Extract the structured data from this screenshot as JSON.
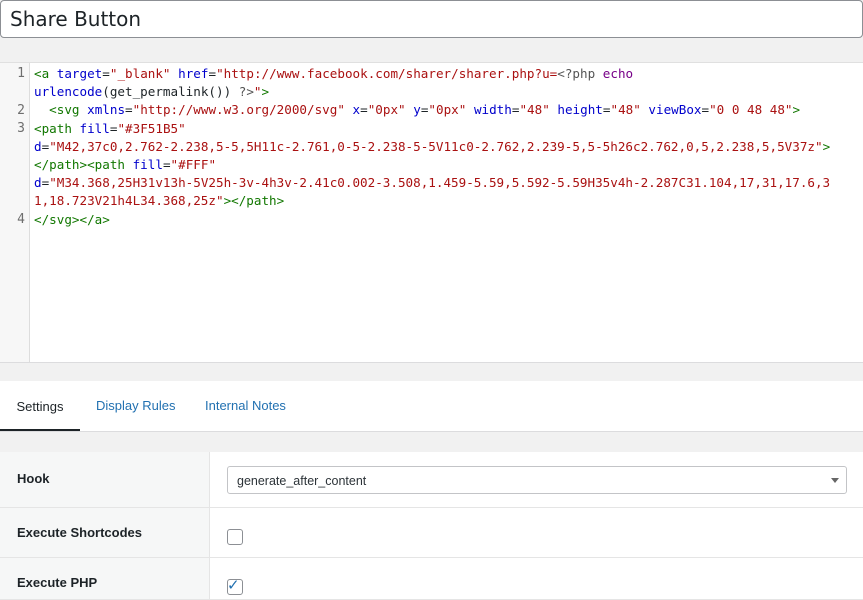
{
  "title": {
    "value": "Share Button"
  },
  "editor": {
    "line_numbers": [
      "1",
      "2",
      "3",
      "4"
    ]
  },
  "tabs": [
    {
      "label": "Settings"
    },
    {
      "label": "Display Rules"
    },
    {
      "label": "Internal Notes"
    }
  ],
  "settings": {
    "hook": {
      "label": "Hook",
      "value": "generate_after_content"
    },
    "execute_shortcodes": {
      "label": "Execute Shortcodes",
      "checked": false
    },
    "execute_php": {
      "label": "Execute PHP",
      "checked": true
    }
  },
  "colors": {
    "accent": "#2271b1"
  }
}
